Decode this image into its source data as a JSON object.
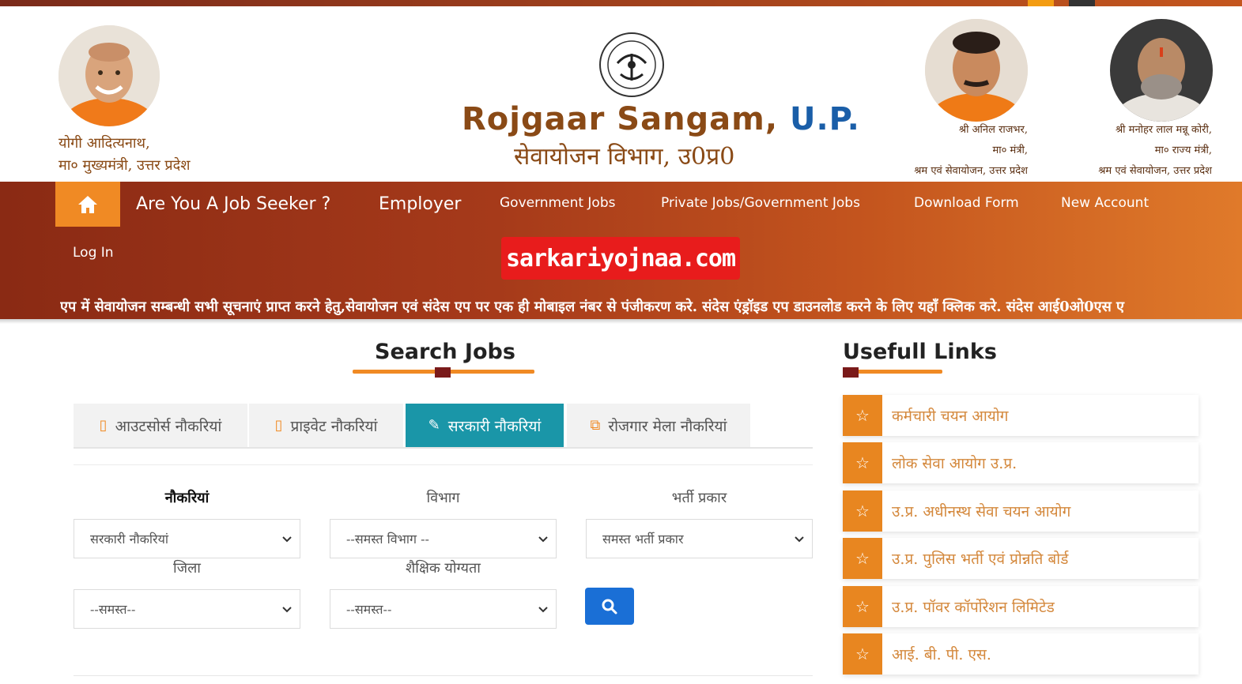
{
  "header": {
    "left_caption": [
      "योगी आदित्यनाथ,",
      "मा० मुख्यमंत्री, उत्तर प्रदेश"
    ],
    "brand_title_main": "Rojgaar Sangam,",
    "brand_title_state": "U.P.",
    "brand_subtitle": "सेवायोजन विभाग, उ0प्र0",
    "right_caption_1": [
      "श्री अनिल राजभर,",
      "मा० मंत्री,",
      "श्रम एवं सेवायोजन, उत्तर प्रदेश"
    ],
    "right_caption_2": [
      "श्री मनोहर लाल मन्नू कोरी,",
      "मा० राज्य मंत्री,",
      "श्रम एवं सेवायोजन, उत्तर प्रदेश"
    ]
  },
  "nav": {
    "items": [
      {
        "label": "Are You A Job Seeker ?"
      },
      {
        "label": "Employer"
      },
      {
        "label": "Government Jobs"
      },
      {
        "label": "Private Jobs/Government Jobs"
      },
      {
        "label": "Download Form"
      },
      {
        "label": "New Account"
      }
    ],
    "login": "Log In",
    "watermark": "sarkariyojnaa.com",
    "marquee": "एप में सेवायोजन सम्बन्धी सभी सूचनाएं प्राप्त करने हेतु,सेवायोजन एवं संदेस एप पर एक ही मोबाइल नंबर से पंजीकरण करे.    संदेस एंड्रॉइड एप डाउनलोड करने के लिए यहाँ क्लिक करे.     संदेस आई0ओ0एस ए"
  },
  "search": {
    "title": "Search Jobs",
    "tabs": [
      {
        "label": "आउटसोर्स नौकरियां",
        "icon": "▯"
      },
      {
        "label": "प्राइवेट नौकरियां",
        "icon": "▯"
      },
      {
        "label": "सरकारी नौकरियां",
        "icon": "✎"
      },
      {
        "label": "रोजगार मेला नौकरियां",
        "icon": "⧉"
      }
    ],
    "active_tab": 2,
    "fields": {
      "jobs_label": "नौकरियां",
      "jobs_value": "सरकारी नौकरियां",
      "dept_label": "विभाग",
      "dept_value": "--समस्त विभाग --",
      "recruit_label": "भर्ती प्रकार",
      "recruit_value": "समस्त भर्ती प्रकार",
      "district_label": "जिला",
      "district_value": "--समस्त--",
      "edu_label": "शैक्षिक योग्यता",
      "edu_value": "--समस्त--"
    }
  },
  "links": {
    "title": "Usefull Links",
    "items": [
      "कर्मचारी चयन आयोग",
      "लोक सेवा आयोग उ.प्र.",
      "उ.प्र. अधीनस्थ सेवा चयन आयोग",
      "उ.प्र. पुलिस भर्ती एवं प्रोन्नति बोर्ड",
      "उ.प्र. पॉवर कॉर्पोरेशन लिमिटेड",
      "आई. बी. पी. एस."
    ]
  },
  "colors": {
    "accent_orange": "#f08a24",
    "nav_dark": "#8a2a14",
    "active_tab": "#1a96a8",
    "search_button": "#1a6fd6",
    "watermark_red": "#e81c1c"
  }
}
